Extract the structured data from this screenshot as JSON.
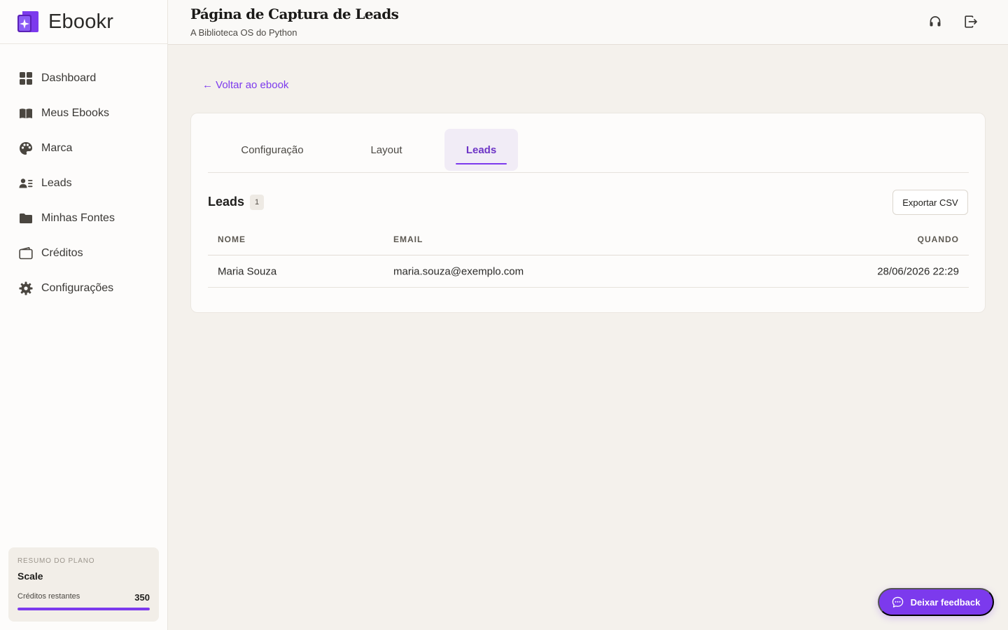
{
  "brand": {
    "name": "Ebookr",
    "accent": "#7c3aed"
  },
  "sidebar": {
    "items": [
      {
        "label": "Dashboard",
        "icon": "grid-icon"
      },
      {
        "label": "Meus Ebooks",
        "icon": "book-icon"
      },
      {
        "label": "Marca",
        "icon": "palette-icon"
      },
      {
        "label": "Leads",
        "icon": "user-list-icon"
      },
      {
        "label": "Minhas Fontes",
        "icon": "folder-icon"
      },
      {
        "label": "Créditos",
        "icon": "wallet-icon"
      },
      {
        "label": "Configurações",
        "icon": "gear-icon"
      }
    ],
    "plan": {
      "label": "RESUMO DO PLANO",
      "name": "Scale",
      "credits_label": "Créditos restantes",
      "credits_value": "350",
      "credits_fraction": 1.0
    }
  },
  "header": {
    "title": "Página de Captura de Leads",
    "subtitle": "A Biblioteca OS do Python",
    "icons": [
      "headset-icon",
      "logout-icon"
    ]
  },
  "main": {
    "back_link": "← Voltar ao ebook",
    "tabs": [
      {
        "label": "Configuração",
        "active": false
      },
      {
        "label": "Layout",
        "active": false
      },
      {
        "label": "Leads",
        "active": true
      }
    ],
    "leads": {
      "title": "Leads",
      "count": "1",
      "export_label": "Exportar CSV",
      "columns": {
        "name": "NOME",
        "email": "EMAIL",
        "when": "QUANDO"
      },
      "rows": [
        {
          "name": "Maria Souza",
          "email": "maria.souza@exemplo.com",
          "when": "28/06/2026 22:29"
        }
      ]
    }
  },
  "feedback": {
    "label": "Deixar feedback",
    "icon": "chat-icon"
  }
}
